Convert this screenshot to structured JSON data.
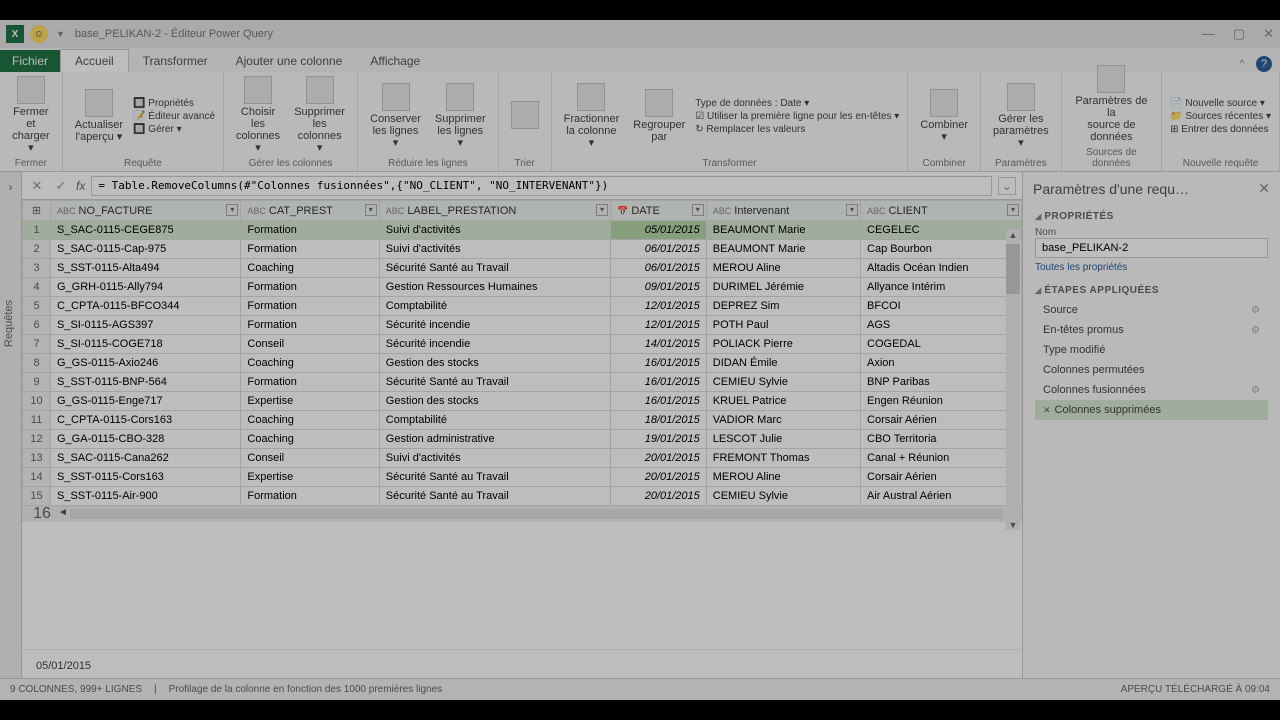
{
  "title": "base_PELIKAN-2 - Éditeur Power Query",
  "tabs": {
    "file": "Fichier",
    "list": [
      "Accueil",
      "Transformer",
      "Ajouter une colonne",
      "Affichage"
    ],
    "active": 0
  },
  "ribbon": {
    "groups": [
      {
        "label": "Fermer",
        "buttons": [
          {
            "label": "Fermer et\ncharger ▾"
          }
        ]
      },
      {
        "label": "Requête",
        "buttons": [
          {
            "label": "Actualiser\nl'aperçu ▾"
          }
        ],
        "side": [
          "🔲 Propriétés",
          "📝 Éditeur avancé",
          "🔲 Gérer ▾"
        ]
      },
      {
        "label": "Gérer les colonnes",
        "buttons": [
          {
            "label": "Choisir les\ncolonnes ▾"
          },
          {
            "label": "Supprimer les\ncolonnes ▾"
          }
        ]
      },
      {
        "label": "Réduire les lignes",
        "buttons": [
          {
            "label": "Conserver\nles lignes ▾"
          },
          {
            "label": "Supprimer\nles lignes ▾"
          }
        ]
      },
      {
        "label": "Trier",
        "buttons": [
          {
            "label": ""
          }
        ]
      },
      {
        "label": "Transformer",
        "buttons": [
          {
            "label": "Fractionner\nla colonne ▾"
          },
          {
            "label": "Regrouper\npar"
          }
        ],
        "side": [
          "Type de données : Date ▾",
          "☑ Utiliser la première ligne pour les en-têtes ▾",
          "↻ Remplacer les valeurs"
        ]
      },
      {
        "label": "Combiner",
        "buttons": [
          {
            "label": "Combiner\n▾"
          }
        ]
      },
      {
        "label": "Paramètres",
        "buttons": [
          {
            "label": "Gérer les\nparamètres ▾"
          }
        ]
      },
      {
        "label": "Sources de données",
        "buttons": [
          {
            "label": "Paramètres de la\nsource de données"
          }
        ]
      },
      {
        "label": "Nouvelle requête",
        "side": [
          "📄 Nouvelle source ▾",
          "📁 Sources récentes ▾",
          "⊞ Entrer des données"
        ]
      }
    ]
  },
  "formula": "= Table.RemoveColumns(#\"Colonnes fusionnées\",{\"NO_CLIENT\", \"NO_INTERVENANT\"})",
  "columns": [
    {
      "name": "NO_FACTURE",
      "type": "ABC"
    },
    {
      "name": "CAT_PREST",
      "type": "ABC"
    },
    {
      "name": "LABEL_PRESTATION",
      "type": "ABC"
    },
    {
      "name": "DATE",
      "type": "📅"
    },
    {
      "name": "Intervenant",
      "type": "ABC"
    },
    {
      "name": "CLIENT",
      "type": "ABC"
    }
  ],
  "rows": [
    [
      "S_SAC-0115-CEGE875",
      "Formation",
      "Suivi d'activités",
      "05/01/2015",
      "BEAUMONT Marie",
      "CEGELEC"
    ],
    [
      "S_SAC-0115-Cap-975",
      "Formation",
      "Suivi d'activités",
      "06/01/2015",
      "BEAUMONT Marie",
      "Cap Bourbon"
    ],
    [
      "S_SST-0115-Alta494",
      "Coaching",
      "Sécurité Santé au Travail",
      "06/01/2015",
      "MEROU Aline",
      "Altadis Océan Indien"
    ],
    [
      "G_GRH-0115-Ally794",
      "Formation",
      "Gestion Ressources Humaines",
      "09/01/2015",
      "DURIMEL Jérémie",
      "Allyance Intérim"
    ],
    [
      "C_CPTA-0115-BFCO344",
      "Formation",
      "Comptabilité",
      "12/01/2015",
      "DEPREZ Sim",
      "BFCOI"
    ],
    [
      "S_SI-0115-AGS397",
      "Formation",
      "Sécurité incendie",
      "12/01/2015",
      "POTH Paul",
      "AGS"
    ],
    [
      "S_SI-0115-COGE718",
      "Conseil",
      "Sécurité incendie",
      "14/01/2015",
      "POLIACK Pierre",
      "COGEDAL"
    ],
    [
      "G_GS-0115-Axio246",
      "Coaching",
      "Gestion des stocks",
      "16/01/2015",
      "DIDAN Émile",
      "Axion"
    ],
    [
      "S_SST-0115-BNP-564",
      "Formation",
      "Sécurité Santé au Travail",
      "16/01/2015",
      "CEMIEU Sylvie",
      "BNP Paribas"
    ],
    [
      "G_GS-0115-Enge717",
      "Expertise",
      "Gestion des stocks",
      "16/01/2015",
      "KRUEL Patrice",
      "Engen  Réunion"
    ],
    [
      "C_CPTA-0115-Cors163",
      "Coaching",
      "Comptabilité",
      "18/01/2015",
      "VADIOR Marc",
      "Corsair Aérien"
    ],
    [
      "G_GA-0115-CBO-328",
      "Coaching",
      "Gestion administrative",
      "19/01/2015",
      "LESCOT Julie",
      "CBO Territoria"
    ],
    [
      "S_SAC-0115-Cana262",
      "Conseil",
      "Suivi d'activités",
      "20/01/2015",
      "FREMONT Thomas",
      "Canal + Réunion"
    ],
    [
      "S_SST-0115-Cors163",
      "Expertise",
      "Sécurité Santé au Travail",
      "20/01/2015",
      "MEROU Aline",
      "Corsair Aérien"
    ],
    [
      "S_SST-0115-Air-900",
      "Formation",
      "Sécurité Santé au Travail",
      "20/01/2015",
      "CEMIEU Sylvie",
      "Air Austral Aérien"
    ]
  ],
  "preview_value": "05/01/2015",
  "rightpanel": {
    "title": "Paramètres d'une requ…",
    "props_label": "PROPRIÉTÉS",
    "name_label": "Nom",
    "name_value": "base_PELIKAN-2",
    "allprops": "Toutes les propriétés",
    "steps_label": "ÉTAPES APPLIQUÉES",
    "steps": [
      {
        "label": "Source",
        "gear": true
      },
      {
        "label": "En-têtes promus",
        "gear": true
      },
      {
        "label": "Type modifié",
        "gear": false
      },
      {
        "label": "Colonnes permutées",
        "gear": false
      },
      {
        "label": "Colonnes fusionnées",
        "gear": true
      },
      {
        "label": "Colonnes supprimées",
        "gear": false,
        "selected": true
      }
    ]
  },
  "statusbar": {
    "left": "9 COLONNES, 999+ LIGNES",
    "mid": "Profilage de la colonne en fonction des 1000 premières lignes",
    "right": "APERÇU TÉLÉCHARGÉ À 09:04"
  },
  "sidelabel": "Requêtes"
}
